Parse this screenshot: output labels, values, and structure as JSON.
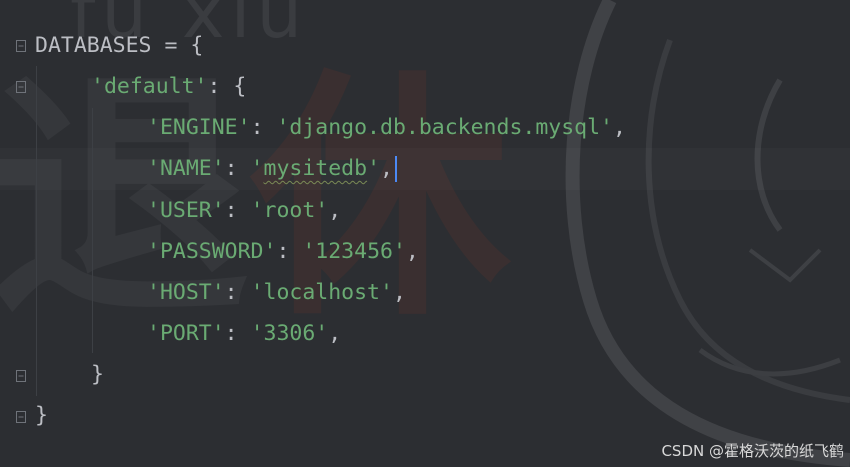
{
  "code": {
    "line1": "DATABASES = {",
    "default_key": "'default'",
    "default_open": ": {",
    "engine_key": "'ENGINE'",
    "engine_val": "'django.db.backends.mysql'",
    "name_key": "'NAME'",
    "name_q1": "'",
    "name_val": "mysitedb",
    "name_q2": "'",
    "user_key": "'USER'",
    "user_val": "'root'",
    "password_key": "'PASSWORD'",
    "password_val": "'123456'",
    "host_key": "'HOST'",
    "host_val": "'localhost'",
    "port_key": "'PORT'",
    "port_val": "'3306'",
    "sep": ": ",
    "comma": ",",
    "inner_close": "}",
    "outer_close": "}"
  },
  "wallpaper": {
    "top_text": "fu xiu",
    "glyph_1": "退",
    "glyph_2": "休"
  },
  "watermark": "CSDN @霍格沃茨的纸飞鹤",
  "colors": {
    "background": "#2c2e32",
    "string": "#6aab73",
    "text": "#bcbec4",
    "caret": "#4c8af5"
  }
}
